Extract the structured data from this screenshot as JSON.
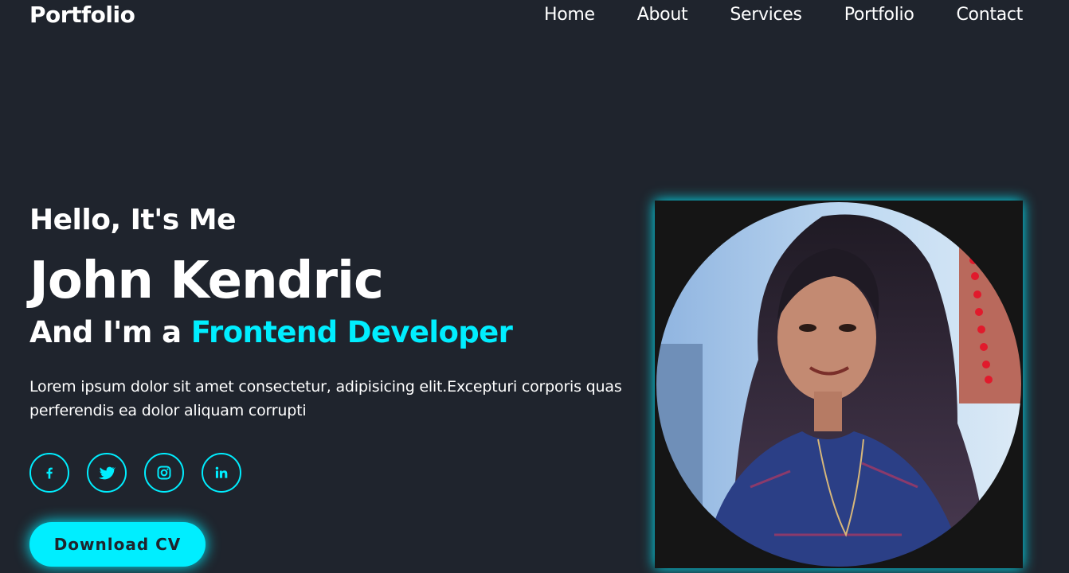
{
  "header": {
    "logo": "Portfolio",
    "nav": [
      {
        "label": "Home"
      },
      {
        "label": "About"
      },
      {
        "label": "Services"
      },
      {
        "label": "Portfolio"
      },
      {
        "label": "Contact"
      }
    ]
  },
  "hero": {
    "greeting": "Hello, It's Me",
    "name": "John Kendric",
    "role_prefix": "And I'm a ",
    "role_highlight": "Frontend Developer",
    "description": "Lorem ipsum dolor sit amet consectetur, adipisicing elit.Excepturi corporis quas perferendis ea dolor aliquam corrupti",
    "socials": [
      {
        "icon": "facebook-icon"
      },
      {
        "icon": "twitter-icon"
      },
      {
        "icon": "instagram-icon"
      },
      {
        "icon": "linkedin-icon"
      }
    ],
    "download_label": "Download CV"
  },
  "colors": {
    "background": "#1f242d",
    "accent": "#00eeff",
    "text": "#ffffff"
  }
}
